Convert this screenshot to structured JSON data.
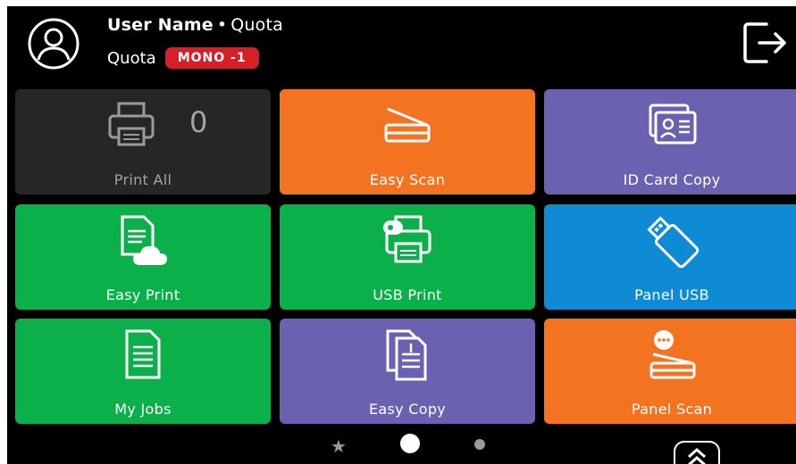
{
  "header": {
    "user_name": "User Name",
    "separator": "•",
    "quota_title": "Quota",
    "quota_label": "Quota",
    "quota_badge": "MONO -1",
    "badge_color": "#d61f26"
  },
  "tiles": [
    {
      "label": "Print All",
      "icon": "printer-icon",
      "count": "0",
      "color": "#262626"
    },
    {
      "label": "Easy Scan",
      "icon": "scanner-icon",
      "color": "#f47321"
    },
    {
      "label": "ID Card Copy",
      "icon": "id-card-icon",
      "color": "#6a62b0"
    },
    {
      "label": "Easy Print",
      "icon": "cloud-document-icon",
      "color": "#0cb04a"
    },
    {
      "label": "USB Print",
      "icon": "usb-printer-icon",
      "color": "#0cb04a"
    },
    {
      "label": "Panel USB",
      "icon": "usb-drive-icon",
      "color": "#0f8bd6"
    },
    {
      "label": "My Jobs",
      "icon": "document-icon",
      "color": "#0cb04a"
    },
    {
      "label": "Easy Copy",
      "icon": "copy-icon",
      "color": "#6a62b0"
    },
    {
      "label": "Panel Scan",
      "icon": "panel-scan-icon",
      "color": "#f47321"
    }
  ],
  "pager": {
    "pages": 2,
    "active_page": 1,
    "favorites_icon": "star-icon",
    "expand_icon": "double-chevron-up-icon"
  }
}
